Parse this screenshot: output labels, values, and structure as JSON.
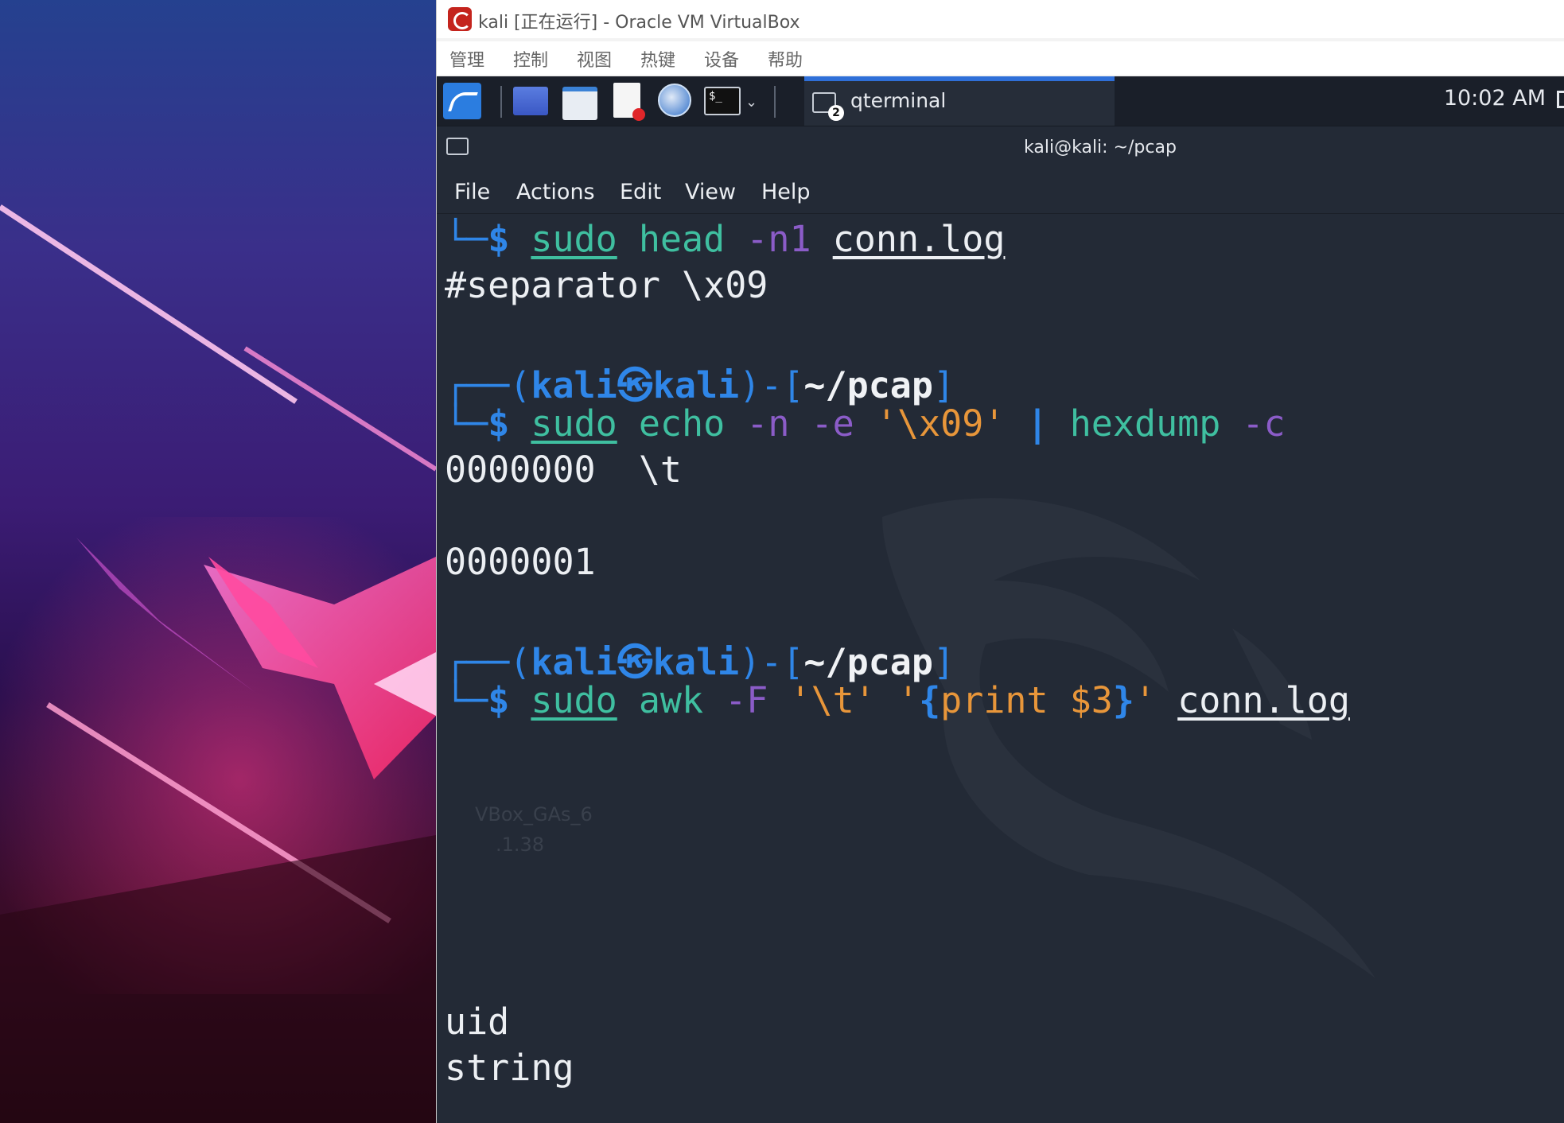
{
  "host": {
    "window_title": "kali [正在运行] - Oracle VM VirtualBox",
    "menu": [
      "管理",
      "控制",
      "视图",
      "热键",
      "设备",
      "帮助"
    ]
  },
  "panel": {
    "task_label": "qterminal",
    "task_badge": "2",
    "clock": "10:02 AM",
    "terminal_button_glyph": "$_"
  },
  "terminal": {
    "window_title": "kali@kali: ~/pcap",
    "menu": [
      "File",
      "Actions",
      "Edit",
      "View",
      "Help"
    ],
    "prompt": {
      "corner_top": "┌──(",
      "user": "kali",
      "at_symbol": "㉿",
      "host": "kali",
      "mid": ")-[",
      "cwd": "~/pcap",
      "end": "]",
      "corner_bottom": "└─",
      "dollar": "$"
    },
    "cmd1": {
      "sudo": "sudo",
      "name": "head",
      "opt": "-n1",
      "file": "conn.log"
    },
    "out1": "#separator \\x09",
    "cmd2": {
      "sudo": "sudo",
      "name": "echo",
      "opt1": "-n",
      "opt2": "-e",
      "arg": "'\\x09'",
      "pipe": "|",
      "name2": "hexdump",
      "opt3": "-c"
    },
    "out2a": "0000000  \\t",
    "out2b": "0000001",
    "cmd3": {
      "sudo": "sudo",
      "name": "awk",
      "opt": "-F",
      "arg1": "'\\t'",
      "arg2_open": "'",
      "brace_open": "{",
      "body": "print $3",
      "brace_close": "}",
      "arg2_close": "'",
      "file": "conn.log"
    },
    "out3a": "uid",
    "out3b": "string"
  },
  "desktop_ghosts": [
    "VBox_GAs_6",
    ".1.38"
  ],
  "colors": {
    "prompt_blue": "#2f86e8",
    "command_teal": "#3fbfa0",
    "option_purple": "#8b5cc8",
    "string_orange": "#e8963a",
    "terminal_bg": "#232a36",
    "panel_accent": "#2f6fd8"
  }
}
